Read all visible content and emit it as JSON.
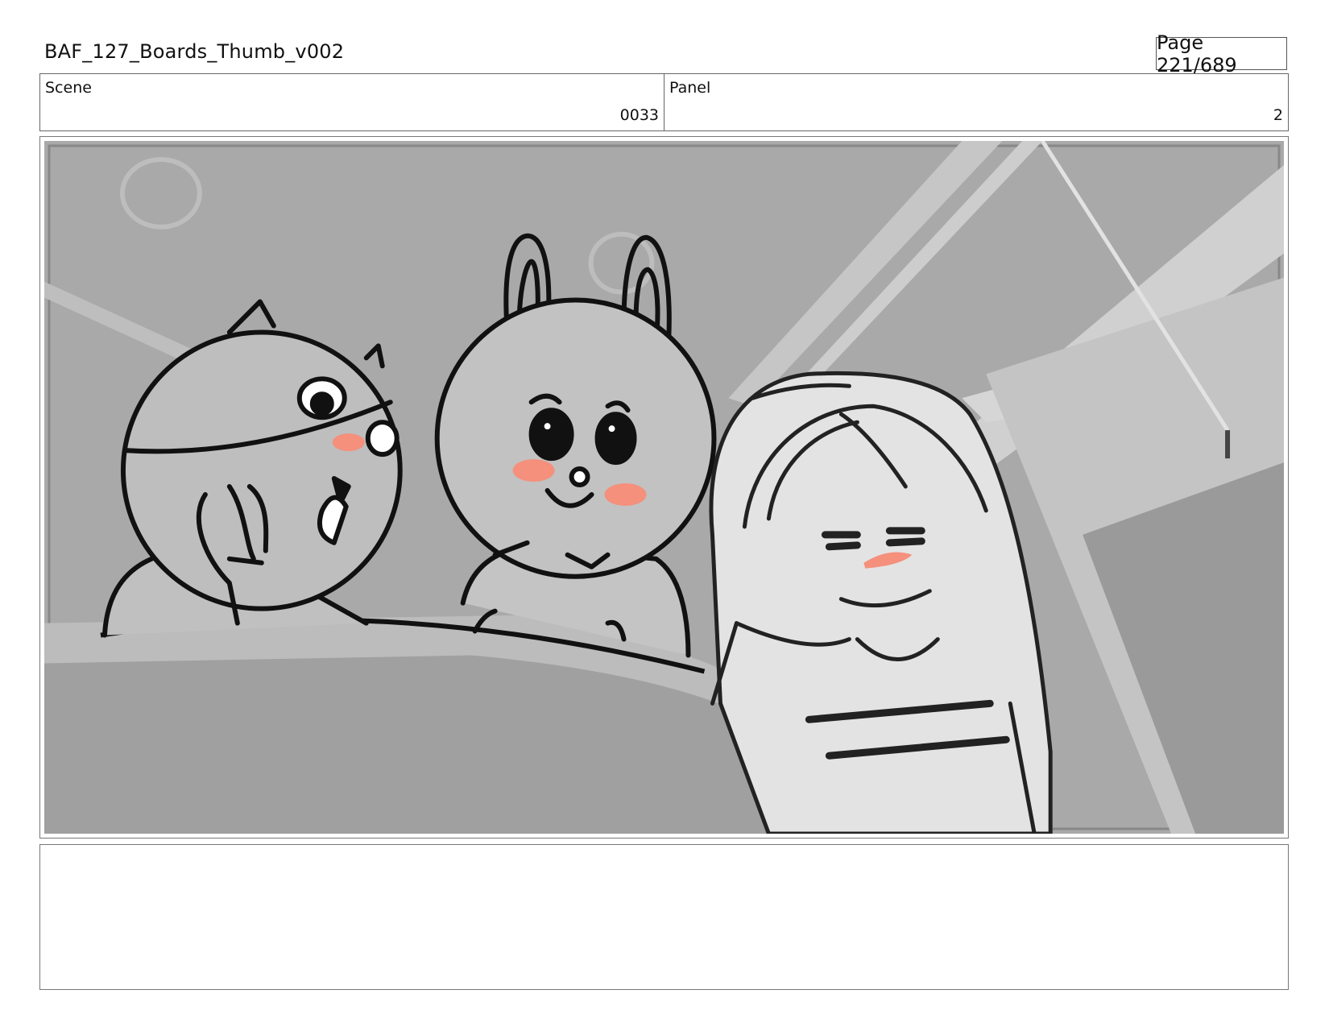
{
  "header": {
    "title": "BAF_127_Boards_Thumb_v002",
    "page": "Page 221/689"
  },
  "fields": {
    "scene_label": "Scene",
    "scene_value": "0033",
    "panel_label": "Panel",
    "panel_value": "2"
  },
  "panel_image": {
    "description_icon": "storyboard-sketch-image",
    "colors": {
      "background": "#a9a9a9",
      "blush": "#f4907c",
      "line": "#111111"
    }
  },
  "notes": {
    "text": ""
  }
}
